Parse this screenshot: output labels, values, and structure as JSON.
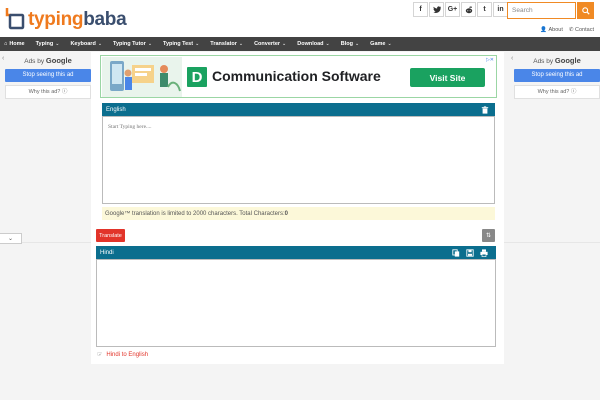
{
  "brand": {
    "logo_part1": "typing",
    "logo_part2": "baba",
    "logo_color_orange": "#ef7a1e",
    "logo_color_blue": "#3a4e6e"
  },
  "social": [
    {
      "name": "facebook-icon",
      "glyph": "f"
    },
    {
      "name": "twitter-icon",
      "glyph": "🐦"
    },
    {
      "name": "google-plus-icon",
      "glyph": "G+"
    },
    {
      "name": "reddit-icon",
      "glyph": "◉"
    },
    {
      "name": "tumblr-icon",
      "glyph": "t"
    },
    {
      "name": "linkedin-icon",
      "glyph": "in"
    }
  ],
  "search": {
    "placeholder": "Search"
  },
  "top_links": {
    "about": "About",
    "contact": "Contact"
  },
  "nav": [
    {
      "label": "Home",
      "has_dropdown": false
    },
    {
      "label": "Typing",
      "has_dropdown": true
    },
    {
      "label": "Keyboard",
      "has_dropdown": true
    },
    {
      "label": "Typing Tutor",
      "has_dropdown": true
    },
    {
      "label": "Typing Test",
      "has_dropdown": true
    },
    {
      "label": "Translator",
      "has_dropdown": true
    },
    {
      "label": "Converter",
      "has_dropdown": true
    },
    {
      "label": "Download",
      "has_dropdown": true
    },
    {
      "label": "Blog",
      "has_dropdown": true
    },
    {
      "label": "Game",
      "has_dropdown": true
    }
  ],
  "ads": {
    "ads_by_prefix": "Ads by",
    "ads_by_brand": "Google",
    "stop_label": "Stop seeing this ad",
    "why_label": "Why this ad? ⓘ"
  },
  "banner": {
    "letter": "D",
    "title": "Communication Software",
    "cta": "Visit Site",
    "accent": "#1aa260"
  },
  "source_panel": {
    "language": "English",
    "placeholder": "Start Typing here...."
  },
  "notice": {
    "text": "Google™ translation is limited to 2000 characters. Total Characters: ",
    "count": "0"
  },
  "actions": {
    "translate": "Translate",
    "swap_glyph": "⇅"
  },
  "target_panel": {
    "language": "Hindi"
  },
  "footer": {
    "link": "Hindi to English"
  },
  "colors": {
    "nav_bg": "#434343",
    "panel_head": "#0b6e8e",
    "accent_orange": "#f08a24",
    "translate_red": "#e2342a",
    "ad_blue": "#4a86e8"
  }
}
